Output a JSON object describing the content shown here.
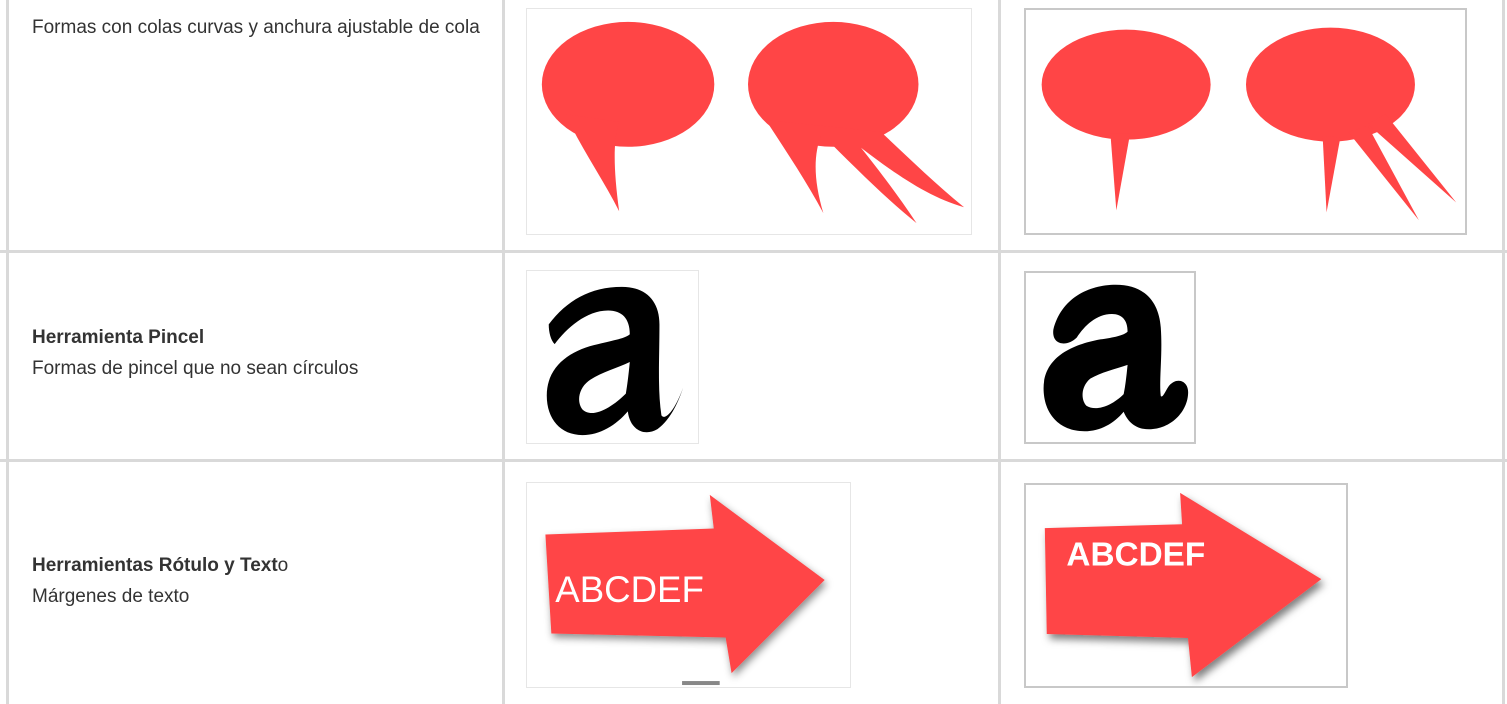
{
  "rows": [
    {
      "title": "",
      "description": "Formas con colas curvas y anchura ajustable de cola",
      "before_image": "speech-bubbles-curved-tails",
      "after_image": "speech-bubbles-straight-tails"
    },
    {
      "title": "Herramienta Pincel",
      "title_suffix": "",
      "description": "Formas de pincel que no sean círculos",
      "before_image": "brush-letter-a-calligraphic",
      "after_image": "brush-letter-a-round"
    },
    {
      "title": "Herramientas Rótulo y Text",
      "title_suffix": "o",
      "description": "Márgenes de texto",
      "before_image": "arrow-label-text-margins",
      "after_image": "arrow-label-text-margins-shadow",
      "arrow_text_before": "ABCDEF",
      "arrow_text_after": "ABCDEF"
    }
  ],
  "colors": {
    "shape_fill": "#ff4546",
    "brush_fill": "#000000",
    "grid_line": "#d9d9d9",
    "text": "#333333"
  }
}
